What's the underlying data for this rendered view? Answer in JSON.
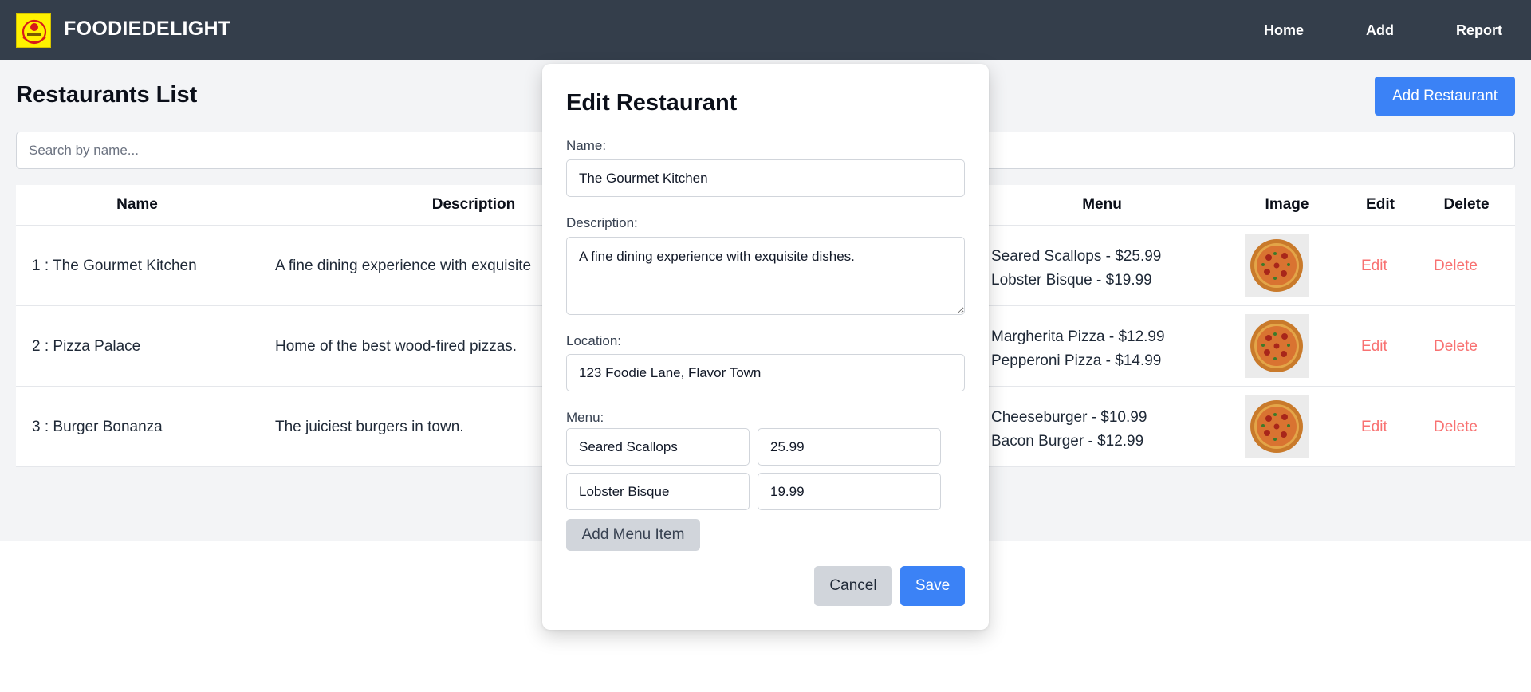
{
  "navbar": {
    "brand": "FOODIEDELIGHT",
    "logo_icon": "foodiedelight-logo",
    "links": [
      "Home",
      "Add",
      "Report"
    ],
    "background": "#343e4b"
  },
  "page": {
    "title": "Restaurants List",
    "add_button": "Add Restaurant",
    "search_placeholder": "Search by name...",
    "accent": "#3b82f6",
    "danger": "#f87171"
  },
  "table": {
    "headers": [
      "Name",
      "Description",
      "Menu",
      "Image",
      "Edit",
      "Delete"
    ],
    "rows": [
      {
        "name": "1 : The Gourmet Kitchen",
        "description": "A fine dining experience with exquisite",
        "menu": [
          "Seared Scallops - $25.99",
          "Lobster Bisque - $19.99"
        ],
        "image_icon": "pizza-image",
        "edit": "Edit",
        "delete": "Delete"
      },
      {
        "name": "2 : Pizza Palace",
        "description": "Home of the best wood-fired pizzas.",
        "menu": [
          "Margherita Pizza - $12.99",
          "Pepperoni Pizza - $14.99"
        ],
        "image_icon": "pizza-image",
        "edit": "Edit",
        "delete": "Delete"
      },
      {
        "name": "3 : Burger Bonanza",
        "description": "The juiciest burgers in town.",
        "menu": [
          "Cheeseburger - $10.99",
          "Bacon Burger - $12.99"
        ],
        "image_icon": "pizza-image",
        "edit": "Edit",
        "delete": "Delete"
      }
    ]
  },
  "modal": {
    "title": "Edit Restaurant",
    "name_label": "Name:",
    "name_value": "The Gourmet Kitchen",
    "description_label": "Description:",
    "description_value": "A fine dining experience with exquisite dishes.",
    "location_label": "Location:",
    "location_value": "123 Foodie Lane, Flavor Town",
    "menu_label": "Menu:",
    "menu_items": [
      {
        "name": "Seared Scallops",
        "price": "25.99"
      },
      {
        "name": "Lobster Bisque",
        "price": "19.99"
      }
    ],
    "add_menu_item": "Add Menu Item",
    "cancel": "Cancel",
    "save": "Save"
  }
}
